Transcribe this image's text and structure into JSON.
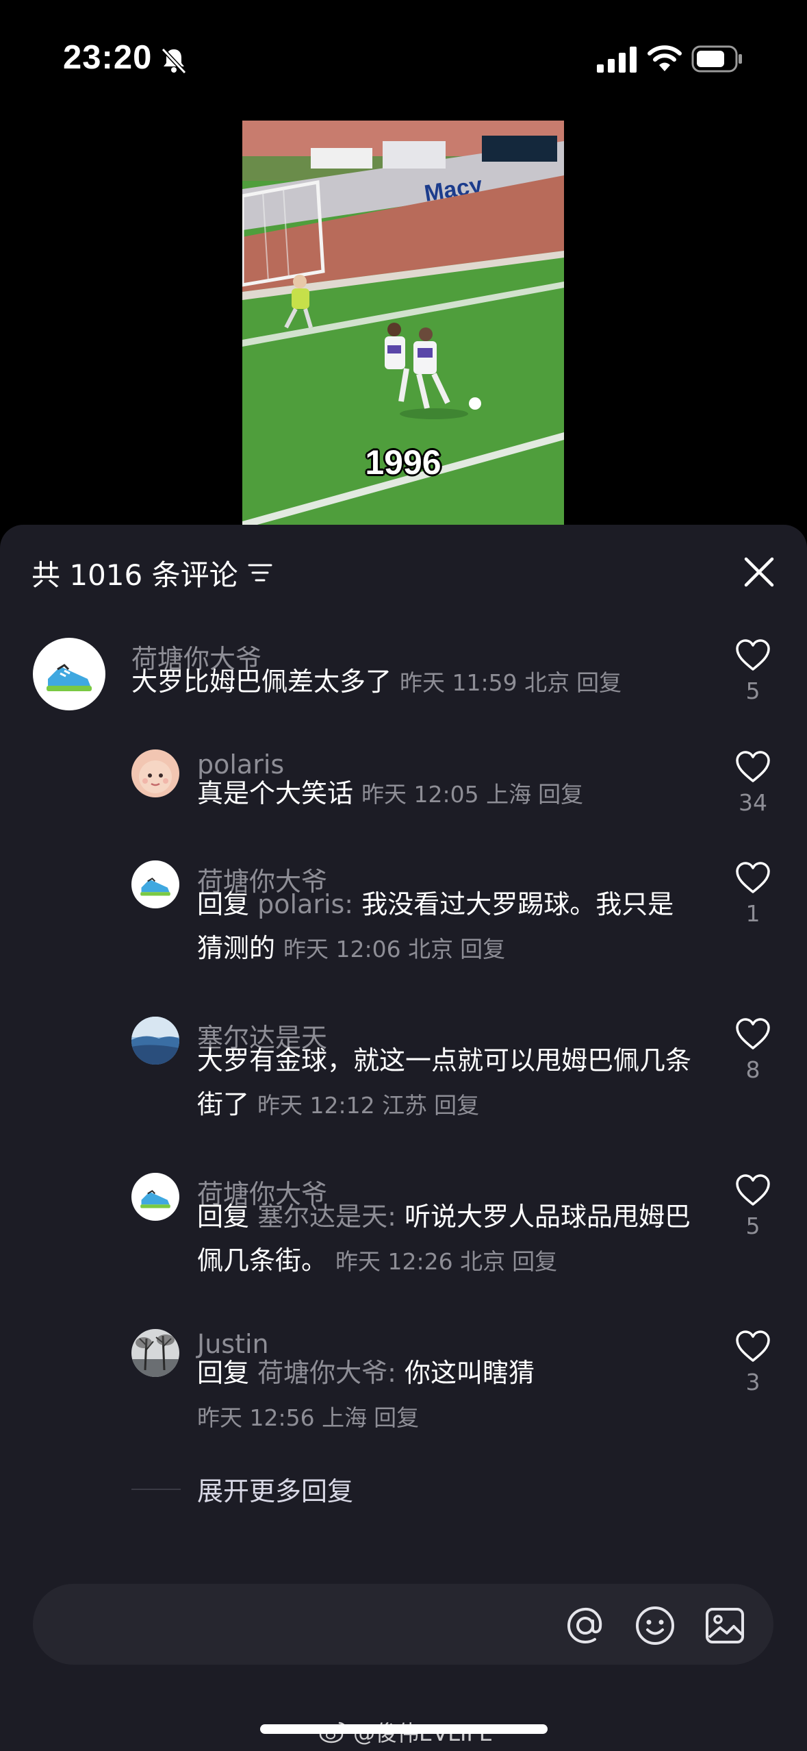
{
  "status_bar": {
    "time": "23:20",
    "icons": [
      "bell-slash-icon",
      "signal-icon",
      "wifi-icon",
      "battery-icon"
    ]
  },
  "video": {
    "caption": "1996",
    "ad_boards": [
      "Macy"
    ]
  },
  "comments_header": {
    "title": "共 1016 条评论",
    "filter_icon": "filter-icon",
    "close_icon": "close-icon"
  },
  "comments": [
    {
      "user": "荷塘你大爷",
      "avatar": "shoe-avatar",
      "text": "大罗比姆巴佩差太多了",
      "time": "昨天 11:59",
      "location": "北京",
      "reply_label": "回复",
      "likes": "5"
    },
    {
      "user": "polaris",
      "avatar": "baby-avatar",
      "text": "真是个大笑话",
      "time": "昨天 12:05",
      "location": "上海",
      "reply_label": "回复",
      "likes": "34"
    },
    {
      "user": "荷塘你大爷",
      "avatar": "shoe-avatar",
      "reply_prefix": "回复",
      "reply_to": "polaris:",
      "text": "我没看过大罗踢球。我只是猜测的",
      "time": "昨天 12:06",
      "location": "北京",
      "reply_label": "回复",
      "likes": "1"
    },
    {
      "user": "塞尔达是天",
      "avatar": "landscape-avatar",
      "text": "大罗有金球，就这一点就可以甩姆巴佩几条街了",
      "time": "昨天 12:12",
      "location": "江苏",
      "reply_label": "回复",
      "likes": "8"
    },
    {
      "user": "荷塘你大爷",
      "avatar": "shoe-avatar",
      "reply_prefix": "回复",
      "reply_to": "塞尔达是天:",
      "text": "听说大罗人品球品甩姆巴佩几条街。",
      "time": "昨天 12:26",
      "location": "北京",
      "reply_label": "回复",
      "likes": "5"
    },
    {
      "user": "Justin",
      "avatar": "trees-avatar",
      "reply_prefix": "回复",
      "reply_to": "荷塘你大爷:",
      "text": "你这叫瞎猜",
      "time": "昨天 12:56",
      "location": "上海",
      "reply_label": "回复",
      "likes": "3"
    }
  ],
  "expand_replies": "展开更多回复",
  "input_bar": {
    "placeholder": "",
    "icons": [
      "at-icon",
      "emoji-icon",
      "image-icon"
    ]
  },
  "watermark": "@俊伟EVLIFE",
  "colors": {
    "sheet_background": "#1c1c25",
    "input_background": "#26262f",
    "secondary_text": "#8e8e96",
    "primary_text": "#ffffff"
  }
}
